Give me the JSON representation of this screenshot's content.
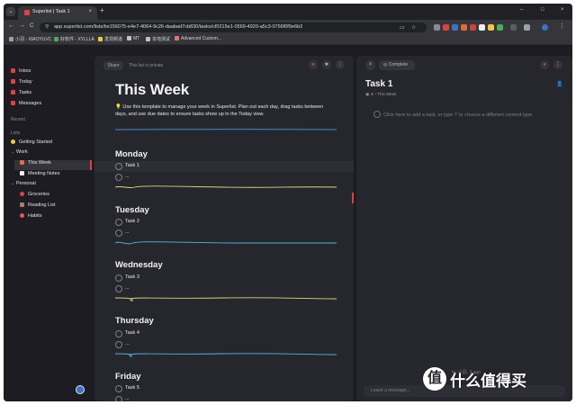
{
  "browser": {
    "tab_title": "Superlist | Task 1",
    "tab_close": "×",
    "new_tab": "+",
    "win_min": "–",
    "win_max": "□",
    "win_close": "×",
    "nav_back": "←",
    "nav_forward": "→",
    "nav_reload": "C",
    "url": "app.superlist.com/lists/be156075-e4e7-4064-9c26-daabad7cb830/tasks/cf0215e1-0569-4920-a5c3-0766f0f9e6b3",
    "bookmarks": [
      {
        "label": "小羽 - XIAOYUVC",
        "color": "#9aa0a6"
      },
      {
        "label": "好软件 - XYLLLA",
        "color": "#4caf50"
      },
      {
        "label": "发现频道",
        "color": "#f5c542"
      },
      {
        "label": "MT",
        "color": "#c0c4c8"
      },
      {
        "label": "本地测试",
        "color": "#c0c4c8"
      },
      {
        "label": "Advanced Custom...",
        "color": "#e57373"
      }
    ]
  },
  "sidebar": {
    "nav": [
      {
        "label": "Inbox",
        "color": "#e0413f"
      },
      {
        "label": "Today",
        "color": "#e0413f"
      },
      {
        "label": "Tasks",
        "color": "#e0413f"
      },
      {
        "label": "Messages",
        "color": "#e0413f"
      }
    ],
    "recent_label": "Recent",
    "lists_label": "Lists",
    "lists": [
      {
        "label": "Getting Started",
        "icon": "wave-emoji",
        "color": "#f5c542"
      },
      {
        "label": "Work",
        "icon": "chevron"
      },
      {
        "label": "This Week",
        "icon": "calendar-emoji",
        "color": "#e96a3c"
      },
      {
        "label": "Meeting Notes",
        "icon": "memo-emoji",
        "color": "#f2f2f2"
      },
      {
        "label": "Personal",
        "icon": "chevron"
      },
      {
        "label": "Groceries",
        "icon": "apple-emoji",
        "color": "#e0413f"
      },
      {
        "label": "Reading List",
        "icon": "books-emoji",
        "color": "#b07c5a"
      },
      {
        "label": "Habits",
        "icon": "circle-emoji",
        "color": "#e05a5a"
      }
    ]
  },
  "main": {
    "share_label": "Share",
    "private_text": "This list is private",
    "title": "This Week",
    "description": "💡 Use this template to manage your week in Superlist. Plan out each day, drag tasks between days, and use due dates to ensure tasks show up in the Today view.",
    "days": [
      {
        "name": "Monday",
        "task": "Task 1",
        "placeholder": "...",
        "wave_color": "#d9d77a"
      },
      {
        "name": "Tuesday",
        "task": "Task 2",
        "placeholder": "...",
        "wave_color": "#4fb6e8"
      },
      {
        "name": "Wednesday",
        "task": "Task 3",
        "placeholder": "...",
        "wave_color": "#d9d77a"
      },
      {
        "name": "Thursday",
        "task": "Task 4",
        "placeholder": "...",
        "wave_color": "#4fb6e8"
      },
      {
        "name": "Friday",
        "task": "Task 5",
        "placeholder": "..."
      }
    ]
  },
  "detail": {
    "complete_label": "Complete",
    "title": "Task 1",
    "meta": "This Week",
    "add_placeholder": "Click here to add a task, or type '/' to choose a different content type",
    "message_placeholder": "Leave a message..."
  },
  "watermark": {
    "logo_char": "值",
    "text": "什么值得买",
    "small": "by 小羽, 3 ago"
  },
  "colors": {
    "accent": "#e0413f",
    "panel": "#26262d",
    "background": "#1c1c22"
  }
}
